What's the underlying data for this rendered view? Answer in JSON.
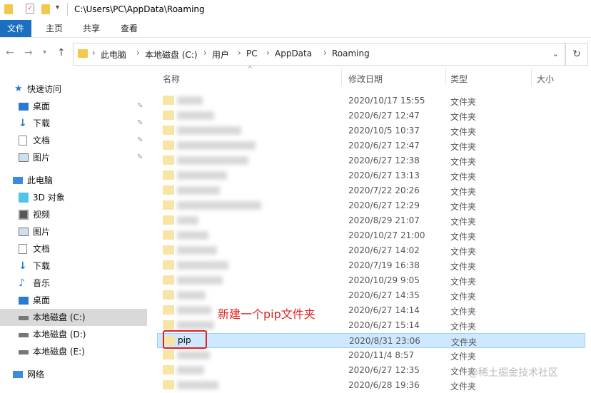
{
  "window": {
    "path": "C:\\Users\\PC\\AppData\\Roaming"
  },
  "menu": {
    "file": "文件",
    "home": "主页",
    "share": "共享",
    "view": "查看"
  },
  "address": {
    "crumbs": [
      "此电脑",
      "本地磁盘 (C:)",
      "用户",
      "PC",
      "AppData",
      "Roaming"
    ]
  },
  "nav": {
    "quick_access": "快速访问",
    "qa_items": [
      "桌面",
      "下载",
      "文档",
      "图片"
    ],
    "this_pc": "此电脑",
    "pc_items": [
      "3D 对象",
      "视频",
      "图片",
      "文档",
      "下载",
      "音乐",
      "桌面",
      "本地磁盘 (C:)",
      "本地磁盘 (D:)",
      "本地磁盘 (E:)"
    ],
    "network": "网络"
  },
  "columns": {
    "name": "名称",
    "modified": "修改日期",
    "type": "类型",
    "size": "大小"
  },
  "files": [
    {
      "date": "2020/10/17 15:55",
      "type": "文件夹"
    },
    {
      "date": "2020/6/27 12:47",
      "type": "文件夹"
    },
    {
      "date": "2020/10/5 10:37",
      "type": "文件夹"
    },
    {
      "date": "2020/6/27 12:47",
      "type": "文件夹"
    },
    {
      "date": "2020/6/27 12:38",
      "type": "文件夹"
    },
    {
      "date": "2020/6/27 13:13",
      "type": "文件夹"
    },
    {
      "date": "2020/7/22 20:26",
      "type": "文件夹"
    },
    {
      "date": "2020/6/27 12:29",
      "type": "文件夹"
    },
    {
      "date": "2020/8/29 21:07",
      "type": "文件夹"
    },
    {
      "date": "2020/10/27 21:00",
      "type": "文件夹"
    },
    {
      "date": "2020/6/27 14:02",
      "type": "文件夹"
    },
    {
      "date": "2020/7/19 16:38",
      "type": "文件夹"
    },
    {
      "date": "2020/10/29 9:05",
      "type": "文件夹"
    },
    {
      "date": "2020/6/27 14:35",
      "type": "文件夹"
    },
    {
      "date": "2020/6/27 14:14",
      "type": "文件夹"
    },
    {
      "date": "2020/6/27 15:14",
      "type": "文件夹"
    },
    {
      "name": "pip",
      "date": "2020/8/31 23:06",
      "type": "文件夹"
    },
    {
      "date": "2020/11/4 8:57",
      "type": "文件夹"
    },
    {
      "date": "2020/6/27 12:35",
      "type": "文件夹"
    },
    {
      "date": "2020/6/28 19:36",
      "type": "文件夹"
    }
  ],
  "annotation": "新建一个pip文件夹",
  "watermark": "@稀土掘金技术社区"
}
